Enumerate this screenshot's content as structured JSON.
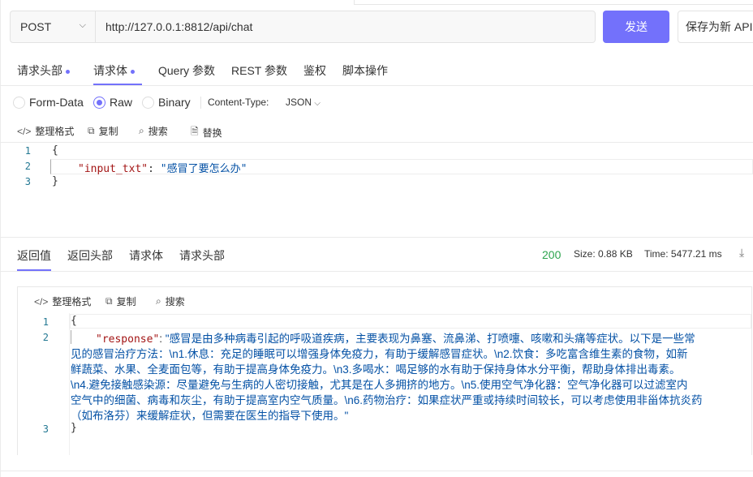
{
  "request": {
    "method": "POST",
    "url": "http://127.0.0.1:8812/api/chat",
    "send_label": "发送",
    "save_label": "保存为新 API"
  },
  "request_tabs": [
    {
      "label": "请求头部",
      "dot": true
    },
    {
      "label": "请求体",
      "dot": true,
      "active": true
    },
    {
      "label": "Query 参数"
    },
    {
      "label": "REST 参数"
    },
    {
      "label": "鉴权"
    },
    {
      "label": "脚本操作"
    }
  ],
  "body_types": {
    "form_data": "Form-Data",
    "raw": "Raw",
    "binary": "Binary",
    "selected": "Raw"
  },
  "content_type_label": "Content-Type:",
  "content_type_value": "JSON",
  "editor_toolbar": {
    "format": "整理格式",
    "copy": "复制",
    "search": "搜索",
    "replace": "替换"
  },
  "request_body": {
    "lines": [
      "1",
      "2",
      "3"
    ],
    "open": "{",
    "key": "\"input_txt\"",
    "colon": ": ",
    "value": "\"感冒了要怎么办\"",
    "close": "}"
  },
  "response_tabs": [
    {
      "label": "返回值",
      "active": true
    },
    {
      "label": "返回头部"
    },
    {
      "label": "请求体"
    },
    {
      "label": "请求头部"
    }
  ],
  "response_status": {
    "code": "200",
    "size": "Size: 0.88 KB",
    "time": "Time: 5477.21 ms",
    "status_color": "#2da44e"
  },
  "response_toolbar": {
    "format": "整理格式",
    "copy": "复制",
    "search": "搜索"
  },
  "response_body": {
    "open": "{",
    "key": "\"response\"",
    "colon": ": ",
    "value_lines": [
      "\"感冒是由多种病毒引起的呼吸道疾病，主要表现为鼻塞、流鼻涕、打喷嚏、咳嗽和头痛等症状。以下是一些常",
      "见的感冒治疗方法：\\n1.休息：充足的睡眠可以增强身体免疫力，有助于缓解感冒症状。\\n2.饮食：多吃富含维生素的食物，如新",
      "鲜蔬菜、水果、全麦面包等，有助于提高身体免疫力。\\n3.多喝水：喝足够的水有助于保持身体水分平衡，帮助身体排出毒素。",
      "\\n4.避免接触感染源：尽量避免与生病的人密切接触，尤其是在人多拥挤的地方。\\n5.使用空气净化器：空气净化器可以过滤室内",
      "空气中的细菌、病毒和灰尘，有助于提高室内空气质量。\\n6.药物治疗：如果症状严重或持续时间较长，可以考虑使用非甾体抗炎药",
      "（如布洛芬）来缓解症状，但需要在医生的指导下使用。\""
    ],
    "close": "}"
  },
  "accent_color": "#7371fb"
}
